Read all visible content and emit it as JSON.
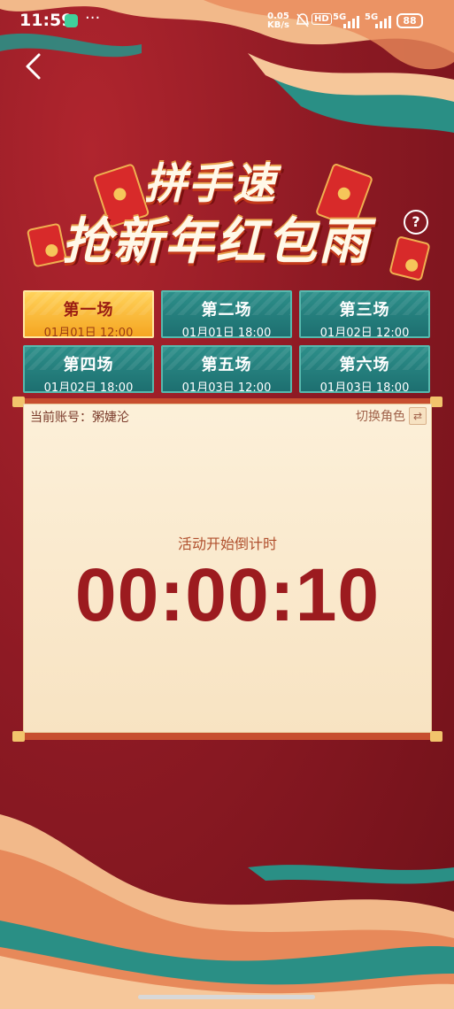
{
  "status_bar": {
    "time": "11:59",
    "more": "···",
    "net_speed_top": "0.05",
    "net_speed_bottom": "KB/s",
    "hd_label": "HD",
    "sig1_label": "5G",
    "sig2_label": "5G",
    "battery": "88"
  },
  "title": {
    "line1": "拼手速",
    "line2": "抢新年红包雨",
    "help": "?"
  },
  "sessions": [
    {
      "name": "第一场",
      "time": "01月01日 12:00",
      "active": true
    },
    {
      "name": "第二场",
      "time": "01月01日 18:00",
      "active": false
    },
    {
      "name": "第三场",
      "time": "01月02日 12:00",
      "active": false
    },
    {
      "name": "第四场",
      "time": "01月02日 18:00",
      "active": false
    },
    {
      "name": "第五场",
      "time": "01月03日 12:00",
      "active": false
    },
    {
      "name": "第六场",
      "time": "01月03日 18:00",
      "active": false
    }
  ],
  "panel": {
    "account": "当前账号：粥婕沦",
    "switch_role": "切换角色",
    "switch_icon": "⇄",
    "countdown_label": "活动开始倒计时",
    "countdown": "00:00:10"
  },
  "colors": {
    "background": "#8f1a24",
    "teal": "#1d6f70",
    "gold": "#f5a622",
    "countdown": "#9c1b1f"
  }
}
